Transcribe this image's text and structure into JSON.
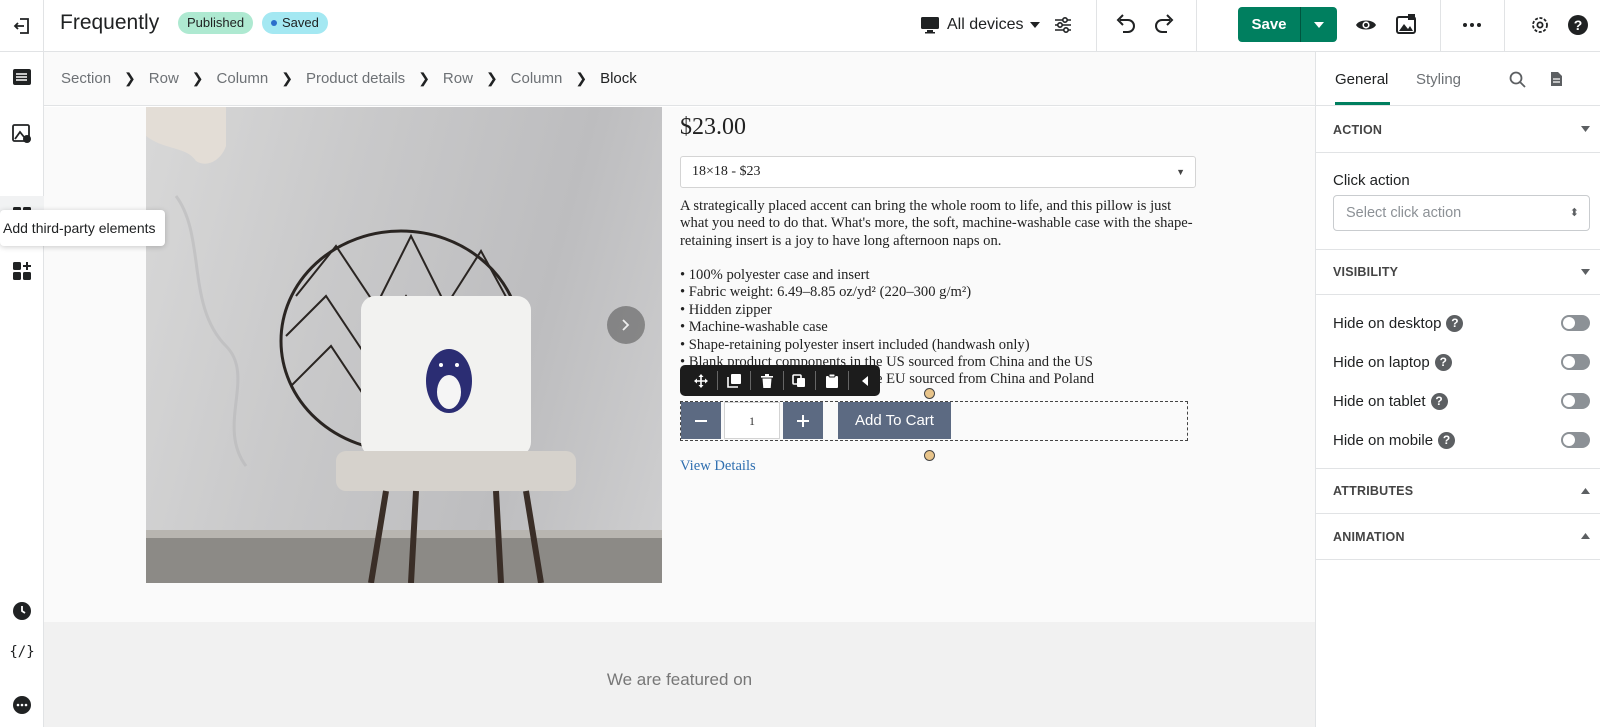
{
  "header": {
    "title": "Frequently",
    "status_badge": "Published",
    "save_status": "Saved",
    "device_selector": "All devices",
    "save_label": "Save"
  },
  "sidebar": {
    "tooltip": "Add third-party elements",
    "code_label": "{/}"
  },
  "breadcrumb": [
    "Section",
    "Row",
    "Column",
    "Product details",
    "Row",
    "Column",
    "Block"
  ],
  "product": {
    "price": "$23.00",
    "variant": "18×18 - $23",
    "description": "A strategically placed accent can bring the whole room to life, and this pillow is just what you need to do that. What's more, the soft, machine-washable case with the shape-retaining insert is a joy to have long afternoon naps on.",
    "bullets": [
      "• 100% polyester case and insert",
      "• Fabric weight: 6.49–8.85 oz/yd² (220–300 g/m²)",
      "• Hidden zipper",
      "• Machine-washable case",
      "• Shape-retaining polyester insert included (handwash only)",
      "• Blank product components in the US sourced from China and the US",
      "• Blank product components in the EU sourced from China and Poland"
    ],
    "quantity": "1",
    "add_to_cart": "Add To Cart",
    "view_details": "View Details"
  },
  "footer_section": {
    "featured_text": "We are featured on"
  },
  "right_panel": {
    "tabs": [
      "General",
      "Styling"
    ],
    "sections": {
      "action": "ACTION",
      "visibility": "VISIBILITY",
      "attributes": "ATTRIBUTES",
      "animation": "ANIMATION"
    },
    "click_action_label": "Click action",
    "click_action_placeholder": "Select click action",
    "visibility_options": [
      "Hide on desktop",
      "Hide on laptop",
      "Hide on tablet",
      "Hide on mobile"
    ]
  },
  "colors": {
    "primary": "#007f5f",
    "published_badge": "#aee9d1",
    "saved_badge": "#a4e8f2",
    "button": "#5c6a82",
    "link": "#2f6fb0"
  }
}
